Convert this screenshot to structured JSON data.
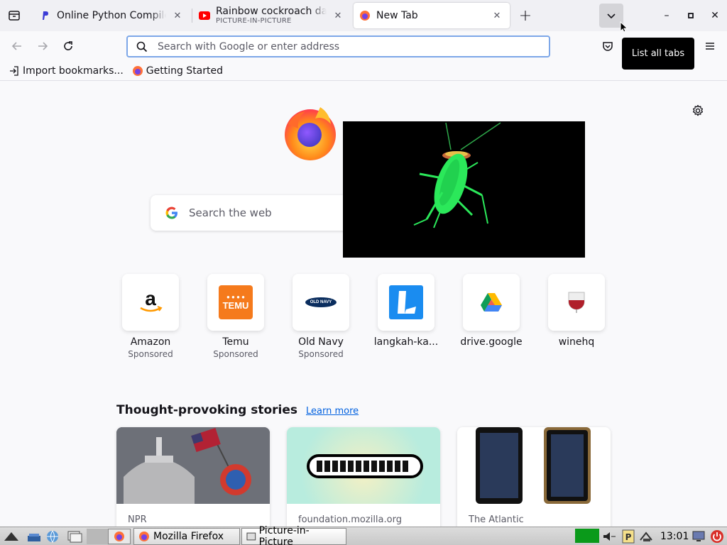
{
  "tabs": [
    {
      "title": "Online Python Compiler (I",
      "close": "✕"
    },
    {
      "title": "Rainbow cockroach danc",
      "subtitle": "PICTURE-IN-PICTURE",
      "close": "✕"
    },
    {
      "title": "New Tab",
      "close": "✕"
    }
  ],
  "toolbar": {
    "new_tab": "+",
    "minimize": "–",
    "maximize": "▫",
    "close": "✕",
    "url_placeholder": "Search with Google or enter address",
    "tooltip": "List all tabs"
  },
  "bookmarks": [
    {
      "label": "Import bookmarks...",
      "icon": "import-icon"
    },
    {
      "label": "Getting Started",
      "icon": "firefox-icon"
    }
  ],
  "newtab": {
    "search_placeholder": "Search the web",
    "top_sites": [
      {
        "name": "Amazon",
        "sponsored": "Sponsored"
      },
      {
        "name": "Temu",
        "sponsored": "Sponsored",
        "logo_text": "TEMU"
      },
      {
        "name": "Old Navy",
        "sponsored": "Sponsored",
        "logo_text": "OLD NAVY"
      },
      {
        "name": "langkah-ka...",
        "sponsored": ""
      },
      {
        "name": "drive.google",
        "sponsored": ""
      },
      {
        "name": "winehq",
        "sponsored": ""
      }
    ],
    "stories_heading": "Thought-provoking stories",
    "learn_more": "Learn more",
    "stories": [
      {
        "source": "NPR"
      },
      {
        "source": "foundation.mozilla.org"
      },
      {
        "source": "The Atlantic"
      }
    ]
  },
  "taskbar": {
    "tasks": [
      {
        "label": "Mozilla Firefox"
      },
      {
        "label": "Picture-in-Picture"
      }
    ],
    "clock": "13:01"
  },
  "colors": {
    "accent": "#0060df",
    "urlbar_border": "#7da7e8",
    "temu_orange": "#f57a1c",
    "oldnavy_navy": "#0a2d5e"
  }
}
